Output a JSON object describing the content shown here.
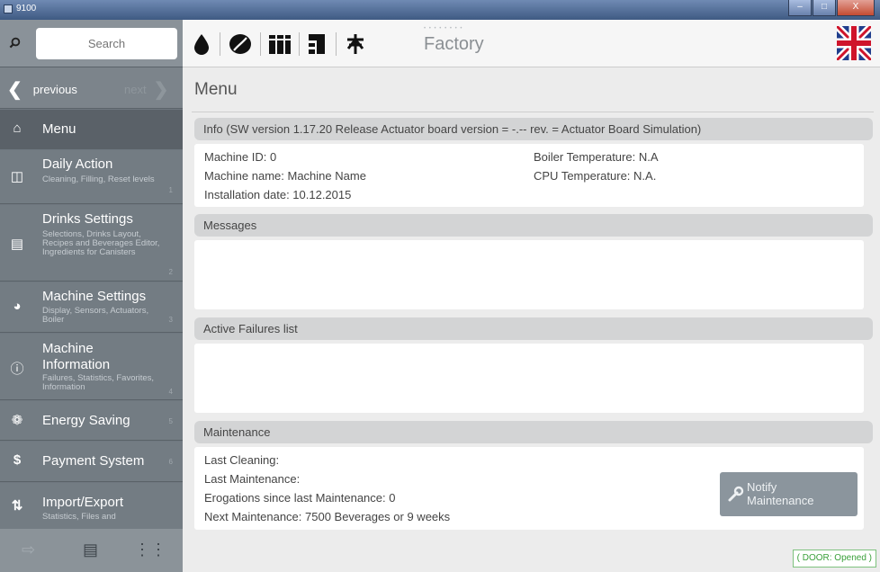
{
  "window": {
    "title": "9100",
    "buttons": [
      "–",
      "□",
      "X"
    ]
  },
  "sidebar": {
    "search_placeholder": "Search",
    "nav": {
      "previous": "previous",
      "next": "next"
    },
    "items": [
      {
        "title": "Menu",
        "subtitle": "",
        "number": "",
        "icon": "home-icon"
      },
      {
        "title": "Daily Action",
        "subtitle": "Cleaning, Filling, Reset levels",
        "number": "1",
        "icon": "clean-icon"
      },
      {
        "title": "Drinks Settings",
        "subtitle": "Selections, Drinks Layout, Recipes and Beverages Editor, Ingredients for Canisters",
        "number": "2",
        "icon": "book-icon"
      },
      {
        "title": "Machine Settings",
        "subtitle": "Display, Sensors, Actuators, Boiler",
        "number": "3",
        "icon": "gauge-icon"
      },
      {
        "title": "Machine Information",
        "subtitle": "Failures, Statistics, Favorites, Information",
        "number": "4",
        "icon": "info-icon"
      },
      {
        "title": "Energy Saving",
        "subtitle": "",
        "number": "5",
        "icon": "leaf-icon"
      },
      {
        "title": "Payment System",
        "subtitle": "",
        "number": "6",
        "icon": "dollar-icon"
      },
      {
        "title": "Import/Export",
        "subtitle": "Statistics, Files and",
        "number": "",
        "icon": "transfer-icon"
      }
    ]
  },
  "toolbar": {
    "icons": [
      "water-drop-icon",
      "coffee-bean-icon",
      "canisters-icon",
      "dispenser-icon",
      "mixer-icon"
    ],
    "factory_label": "Factory",
    "factory_dots": "• • • • • • • •",
    "flag": "uk-flag-icon"
  },
  "main": {
    "title": "Menu",
    "info": {
      "header": "Info (SW version 1.17.20 Release   Actuator board version = -.-- rev. = Actuator Board Simulation)",
      "machine_id": "Machine ID: 0",
      "machine_name": "Machine name: Machine Name",
      "installation_date": "Installation date: 10.12.2015",
      "boiler_temp": "Boiler Temperature: N.A",
      "cpu_temp": "CPU Temperature: N.A."
    },
    "messages": {
      "header": "Messages"
    },
    "failures": {
      "header": "Active Failures list"
    },
    "maintenance": {
      "header": "Maintenance",
      "last_cleaning": "Last Cleaning:",
      "last_maintenance": "Last Maintenance:",
      "erogations": "Erogations since last Maintenance: 0",
      "next_maintenance": "Next Maintenance: 7500 Beverages or 9 weeks",
      "notify_line1": "Notify",
      "notify_line2": "Maintenance"
    },
    "door_status": "( DOOR: Opened )"
  }
}
